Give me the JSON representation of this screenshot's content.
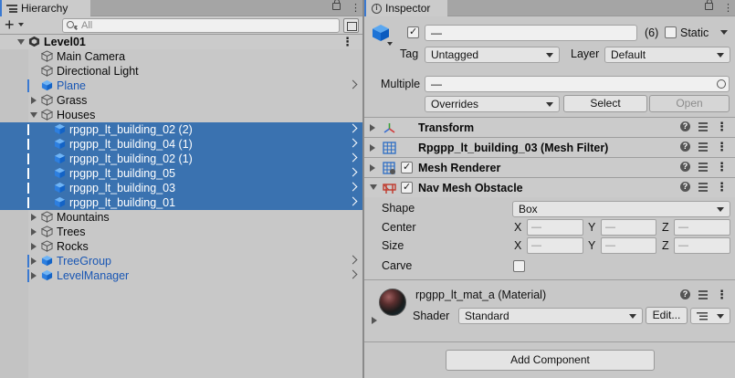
{
  "hierarchy": {
    "tab_label": "Hierarchy",
    "add_label": "+",
    "search_placeholder": "All",
    "rows": [
      {
        "label": "Level01",
        "indent": 0,
        "kind": "scene",
        "foldout": "down",
        "icon": "unity-scene-icon"
      },
      {
        "label": "Main Camera",
        "indent": 1,
        "kind": "object",
        "foldout": "",
        "icon": "gameobject-cube-icon"
      },
      {
        "label": "Directional Light",
        "indent": 1,
        "kind": "object",
        "foldout": "",
        "icon": "gameobject-cube-icon"
      },
      {
        "label": "Plane",
        "indent": 1,
        "kind": "prefab",
        "foldout": "",
        "icon": "prefab-cube-icon"
      },
      {
        "label": "Grass",
        "indent": 1,
        "kind": "object",
        "foldout": "right",
        "icon": "gameobject-cube-icon"
      },
      {
        "label": "Houses",
        "indent": 1,
        "kind": "object",
        "foldout": "down",
        "icon": "gameobject-cube-icon"
      },
      {
        "label": "rpgpp_lt_building_02 (2)",
        "indent": 2,
        "kind": "selected",
        "foldout": "",
        "icon": "prefab-cube-icon"
      },
      {
        "label": "rpgpp_lt_building_04 (1)",
        "indent": 2,
        "kind": "selected",
        "foldout": "",
        "icon": "prefab-cube-icon"
      },
      {
        "label": "rpgpp_lt_building_02 (1)",
        "indent": 2,
        "kind": "selected",
        "foldout": "",
        "icon": "prefab-cube-icon"
      },
      {
        "label": "rpgpp_lt_building_05",
        "indent": 2,
        "kind": "selected",
        "foldout": "",
        "icon": "prefab-cube-icon"
      },
      {
        "label": "rpgpp_lt_building_03",
        "indent": 2,
        "kind": "selected",
        "foldout": "",
        "icon": "prefab-cube-icon"
      },
      {
        "label": "rpgpp_lt_building_01",
        "indent": 2,
        "kind": "selected",
        "foldout": "",
        "icon": "prefab-cube-icon"
      },
      {
        "label": "Mountains",
        "indent": 1,
        "kind": "object",
        "foldout": "right",
        "icon": "gameobject-cube-icon"
      },
      {
        "label": "Trees",
        "indent": 1,
        "kind": "object",
        "foldout": "right",
        "icon": "gameobject-cube-icon"
      },
      {
        "label": "Rocks",
        "indent": 1,
        "kind": "object",
        "foldout": "right",
        "icon": "gameobject-cube-icon"
      },
      {
        "label": "TreeGroup",
        "indent": 1,
        "kind": "prefab",
        "foldout": "right",
        "icon": "prefab-cube-icon"
      },
      {
        "label": "LevelManager",
        "indent": 1,
        "kind": "prefab",
        "foldout": "right",
        "icon": "prefab-cube-icon"
      }
    ]
  },
  "inspector": {
    "tab_label": "Inspector",
    "name_value": "—",
    "count": "(6)",
    "static_label": "Static",
    "tag_label": "Tag",
    "tag_value": "Untagged",
    "layer_label": "Layer",
    "layer_value": "Default",
    "multiple_label": "Multiple",
    "multiple_value": "—",
    "overrides_value": "Overrides",
    "select_button": "Select",
    "open_button": "Open",
    "components": [
      {
        "title": "Transform",
        "icon": "transform-axes-icon",
        "checkbox": false
      },
      {
        "title": "Rpgpp_lt_building_03 (Mesh Filter)",
        "icon": "mesh-filter-grid-icon",
        "checkbox": false
      },
      {
        "title": "Mesh Renderer",
        "icon": "mesh-renderer-grid-icon",
        "checkbox": true
      },
      {
        "title": "Nav Mesh Obstacle",
        "icon": "nav-mesh-obstacle-icon",
        "checkbox": true
      }
    ],
    "nav_obstacle": {
      "shape_label": "Shape",
      "shape_value": "Box",
      "center_label": "Center",
      "size_label": "Size",
      "carve_label": "Carve",
      "x": "X",
      "y": "Y",
      "z": "Z",
      "mixed": "—"
    },
    "material": {
      "name": "rpgpp_lt_mat_a (Material)",
      "shader_label": "Shader",
      "shader_value": "Standard",
      "edit_button": "Edit..."
    },
    "add_component_button": "Add Component"
  },
  "colors": {
    "selection": "#3a72b0",
    "prefab_text": "#1a57b4",
    "accent": "#3a79d1"
  }
}
